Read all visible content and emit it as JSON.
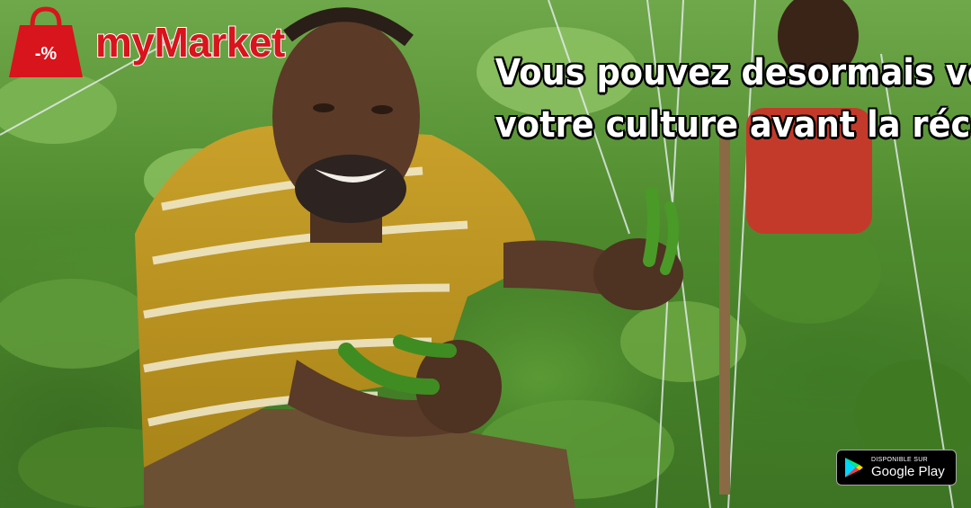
{
  "brand": {
    "badge_text": "-%",
    "name": "myMarket",
    "color": "#d8141c"
  },
  "headline": {
    "line1": "Vous pouvez desormais vendre",
    "line2": "votre culture avant la récolte"
  },
  "store_badge": {
    "small_text": "DISPONIBLE SUR",
    "store_name": "Google Play"
  },
  "icons": {
    "logo": "shopping-bag-icon",
    "store": "play-store-icon"
  }
}
